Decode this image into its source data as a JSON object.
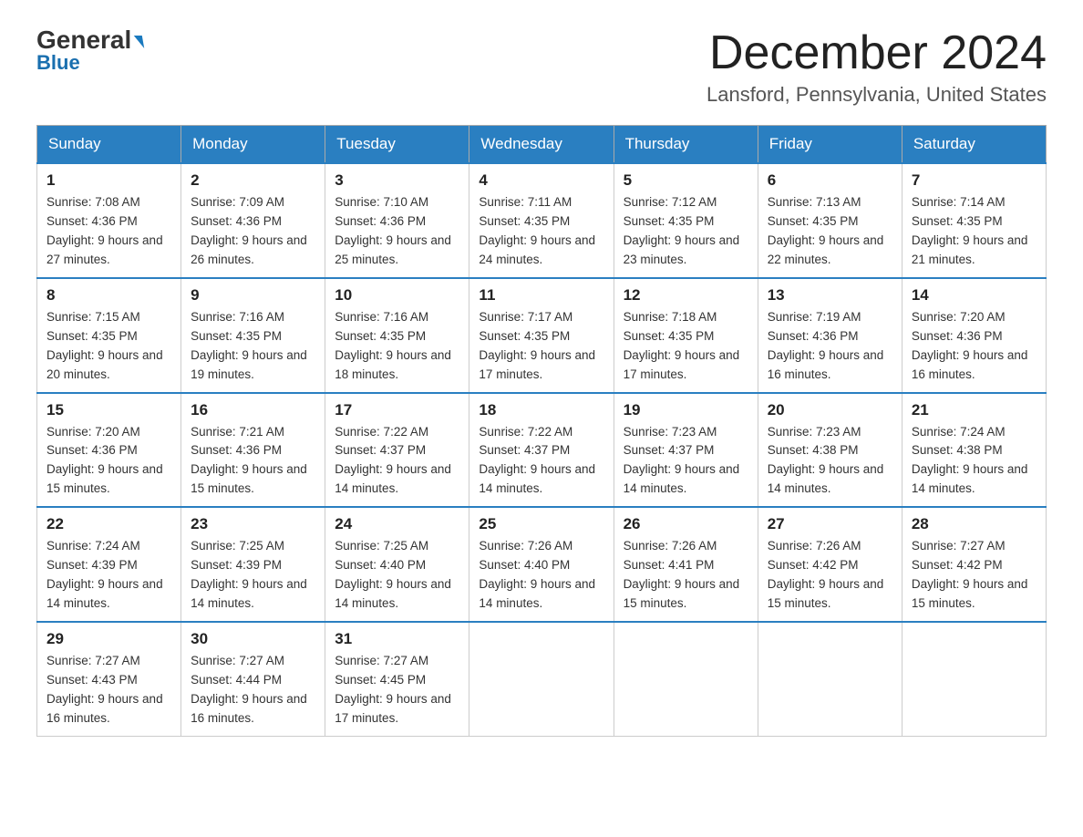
{
  "header": {
    "logo_general": "General",
    "logo_blue": "Blue",
    "month_title": "December 2024",
    "location": "Lansford, Pennsylvania, United States"
  },
  "days_of_week": [
    "Sunday",
    "Monday",
    "Tuesday",
    "Wednesday",
    "Thursday",
    "Friday",
    "Saturday"
  ],
  "weeks": [
    [
      {
        "day": "1",
        "sunrise": "7:08 AM",
        "sunset": "4:36 PM",
        "daylight": "9 hours and 27 minutes."
      },
      {
        "day": "2",
        "sunrise": "7:09 AM",
        "sunset": "4:36 PM",
        "daylight": "9 hours and 26 minutes."
      },
      {
        "day": "3",
        "sunrise": "7:10 AM",
        "sunset": "4:36 PM",
        "daylight": "9 hours and 25 minutes."
      },
      {
        "day": "4",
        "sunrise": "7:11 AM",
        "sunset": "4:35 PM",
        "daylight": "9 hours and 24 minutes."
      },
      {
        "day": "5",
        "sunrise": "7:12 AM",
        "sunset": "4:35 PM",
        "daylight": "9 hours and 23 minutes."
      },
      {
        "day": "6",
        "sunrise": "7:13 AM",
        "sunset": "4:35 PM",
        "daylight": "9 hours and 22 minutes."
      },
      {
        "day": "7",
        "sunrise": "7:14 AM",
        "sunset": "4:35 PM",
        "daylight": "9 hours and 21 minutes."
      }
    ],
    [
      {
        "day": "8",
        "sunrise": "7:15 AM",
        "sunset": "4:35 PM",
        "daylight": "9 hours and 20 minutes."
      },
      {
        "day": "9",
        "sunrise": "7:16 AM",
        "sunset": "4:35 PM",
        "daylight": "9 hours and 19 minutes."
      },
      {
        "day": "10",
        "sunrise": "7:16 AM",
        "sunset": "4:35 PM",
        "daylight": "9 hours and 18 minutes."
      },
      {
        "day": "11",
        "sunrise": "7:17 AM",
        "sunset": "4:35 PM",
        "daylight": "9 hours and 17 minutes."
      },
      {
        "day": "12",
        "sunrise": "7:18 AM",
        "sunset": "4:35 PM",
        "daylight": "9 hours and 17 minutes."
      },
      {
        "day": "13",
        "sunrise": "7:19 AM",
        "sunset": "4:36 PM",
        "daylight": "9 hours and 16 minutes."
      },
      {
        "day": "14",
        "sunrise": "7:20 AM",
        "sunset": "4:36 PM",
        "daylight": "9 hours and 16 minutes."
      }
    ],
    [
      {
        "day": "15",
        "sunrise": "7:20 AM",
        "sunset": "4:36 PM",
        "daylight": "9 hours and 15 minutes."
      },
      {
        "day": "16",
        "sunrise": "7:21 AM",
        "sunset": "4:36 PM",
        "daylight": "9 hours and 15 minutes."
      },
      {
        "day": "17",
        "sunrise": "7:22 AM",
        "sunset": "4:37 PM",
        "daylight": "9 hours and 14 minutes."
      },
      {
        "day": "18",
        "sunrise": "7:22 AM",
        "sunset": "4:37 PM",
        "daylight": "9 hours and 14 minutes."
      },
      {
        "day": "19",
        "sunrise": "7:23 AM",
        "sunset": "4:37 PM",
        "daylight": "9 hours and 14 minutes."
      },
      {
        "day": "20",
        "sunrise": "7:23 AM",
        "sunset": "4:38 PM",
        "daylight": "9 hours and 14 minutes."
      },
      {
        "day": "21",
        "sunrise": "7:24 AM",
        "sunset": "4:38 PM",
        "daylight": "9 hours and 14 minutes."
      }
    ],
    [
      {
        "day": "22",
        "sunrise": "7:24 AM",
        "sunset": "4:39 PM",
        "daylight": "9 hours and 14 minutes."
      },
      {
        "day": "23",
        "sunrise": "7:25 AM",
        "sunset": "4:39 PM",
        "daylight": "9 hours and 14 minutes."
      },
      {
        "day": "24",
        "sunrise": "7:25 AM",
        "sunset": "4:40 PM",
        "daylight": "9 hours and 14 minutes."
      },
      {
        "day": "25",
        "sunrise": "7:26 AM",
        "sunset": "4:40 PM",
        "daylight": "9 hours and 14 minutes."
      },
      {
        "day": "26",
        "sunrise": "7:26 AM",
        "sunset": "4:41 PM",
        "daylight": "9 hours and 15 minutes."
      },
      {
        "day": "27",
        "sunrise": "7:26 AM",
        "sunset": "4:42 PM",
        "daylight": "9 hours and 15 minutes."
      },
      {
        "day": "28",
        "sunrise": "7:27 AM",
        "sunset": "4:42 PM",
        "daylight": "9 hours and 15 minutes."
      }
    ],
    [
      {
        "day": "29",
        "sunrise": "7:27 AM",
        "sunset": "4:43 PM",
        "daylight": "9 hours and 16 minutes."
      },
      {
        "day": "30",
        "sunrise": "7:27 AM",
        "sunset": "4:44 PM",
        "daylight": "9 hours and 16 minutes."
      },
      {
        "day": "31",
        "sunrise": "7:27 AM",
        "sunset": "4:45 PM",
        "daylight": "9 hours and 17 minutes."
      },
      null,
      null,
      null,
      null
    ]
  ]
}
